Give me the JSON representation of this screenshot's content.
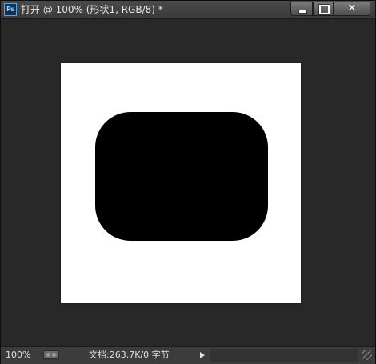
{
  "window": {
    "app_icon_text": "Ps",
    "title": "打开 @ 100% (形状1, RGB/8) *",
    "controls": {
      "minimize": "minimize",
      "maximize": "maximize",
      "close": "✕"
    }
  },
  "canvas": {
    "background_color": "#282828",
    "document_color": "#ffffff",
    "shape": {
      "name": "形状1",
      "fill": "#000000",
      "kind": "rounded-rectangle"
    }
  },
  "status_bar": {
    "zoom": "100%",
    "doc_info": "文档:263.7K/0 字节"
  }
}
